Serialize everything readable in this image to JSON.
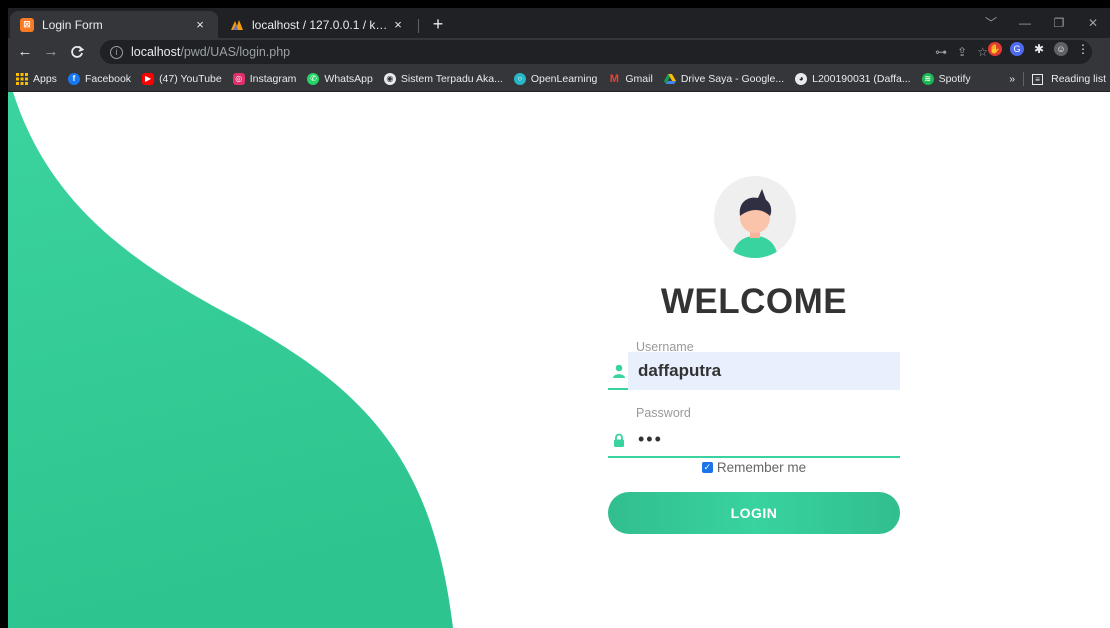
{
  "browser": {
    "tabs": [
      {
        "title": "Login Form",
        "active": true
      },
      {
        "title": "localhost / 127.0.0.1 / kesehatan_",
        "active": false
      }
    ],
    "new_tab": "+",
    "close_glyph": "×",
    "window_controls": [
      "﹀",
      "—",
      "❐",
      "✕"
    ],
    "url_host": "localhost",
    "url_path": "/pwd/UAS/login.php",
    "bookmarks": [
      {
        "label": "Apps",
        "icon": "apps-icon",
        "color": "#fbbc04"
      },
      {
        "label": "Facebook",
        "icon": "facebook-icon",
        "color": "#1877f2"
      },
      {
        "label": "(47) YouTube",
        "icon": "youtube-icon",
        "color": "#ff0000"
      },
      {
        "label": "Instagram",
        "icon": "instagram-icon",
        "color": "#e1306c"
      },
      {
        "label": "WhatsApp",
        "icon": "whatsapp-icon",
        "color": "#25d366"
      },
      {
        "label": "Sistem Terpadu Aka...",
        "icon": "globe-icon",
        "color": "#e8eaed"
      },
      {
        "label": "OpenLearning",
        "icon": "openlearning-icon",
        "color": "#29b6c6"
      },
      {
        "label": "Gmail",
        "icon": "gmail-icon",
        "color": "#ea4335"
      },
      {
        "label": "Drive Saya - Google...",
        "icon": "drive-icon",
        "color": "#fbbc04"
      },
      {
        "label": "L200190031 (Daffa...",
        "icon": "github-icon",
        "color": "#e8eaed"
      },
      {
        "label": "Spotify",
        "icon": "spotify-icon",
        "color": "#1db954"
      }
    ],
    "bookmarks_more": "»",
    "reading_list": "Reading list"
  },
  "page": {
    "accent": "#38d39f",
    "welcome": "WELCOME",
    "username_label": "Username",
    "username_value": "daffaputra",
    "password_label": "Password",
    "password_value": "•••",
    "remember_label": "Remember me",
    "remember_checked": true,
    "login_button": "LOGIN"
  }
}
